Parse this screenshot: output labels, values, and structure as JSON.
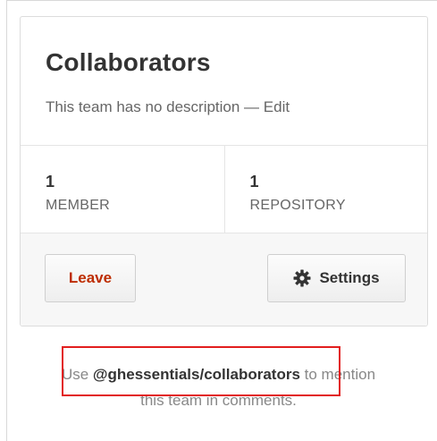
{
  "team": {
    "title": "Collaborators",
    "description": "This team has no description —",
    "edit_label": "Edit"
  },
  "stats": {
    "members": {
      "count": "1",
      "label": "MEMBER"
    },
    "repositories": {
      "count": "1",
      "label": "REPOSITORY"
    }
  },
  "actions": {
    "leave_label": "Leave",
    "settings_label": "Settings",
    "settings_icon": "gear-icon"
  },
  "mention": {
    "prefix": "Use",
    "handle": "@ghessentials/collaborators",
    "suffix_line1": "to mention",
    "suffix_line2": "this team in comments."
  },
  "colors": {
    "leave_text": "#bd2c00",
    "highlight_border": "#e21e1e"
  }
}
